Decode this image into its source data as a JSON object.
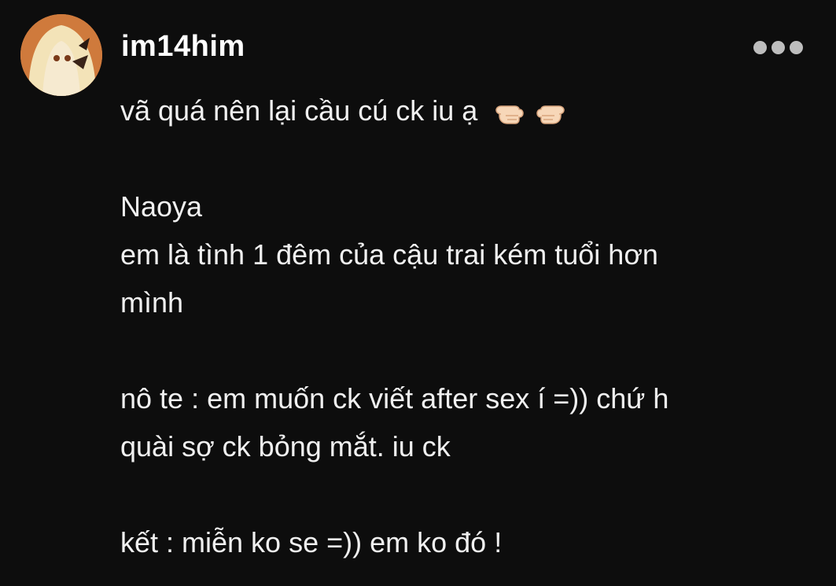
{
  "post": {
    "username": "im14him",
    "avatar_icon": "anime-girl-avatar",
    "more_icon": "more-horizontal-icon",
    "lines": [
      "vã quá nên lại cầu cú ck iu ạ",
      "",
      "Naoya",
      "em là tình 1 đêm của cậu trai kém tuổi hơn",
      "mình",
      "",
      "nô te : em muốn ck viết after sex í =)) chứ h",
      "quài sợ ck bỏng mắt. iu ck",
      "",
      "kết : miễn ko se =)) em ko đó !"
    ],
    "emoji": [
      "backhand-index-left-icon",
      "backhand-index-right-icon"
    ]
  },
  "colors": {
    "background": "#0d0d0d",
    "text": "#f0f0f0",
    "more_dots": "#bdbdbd"
  }
}
